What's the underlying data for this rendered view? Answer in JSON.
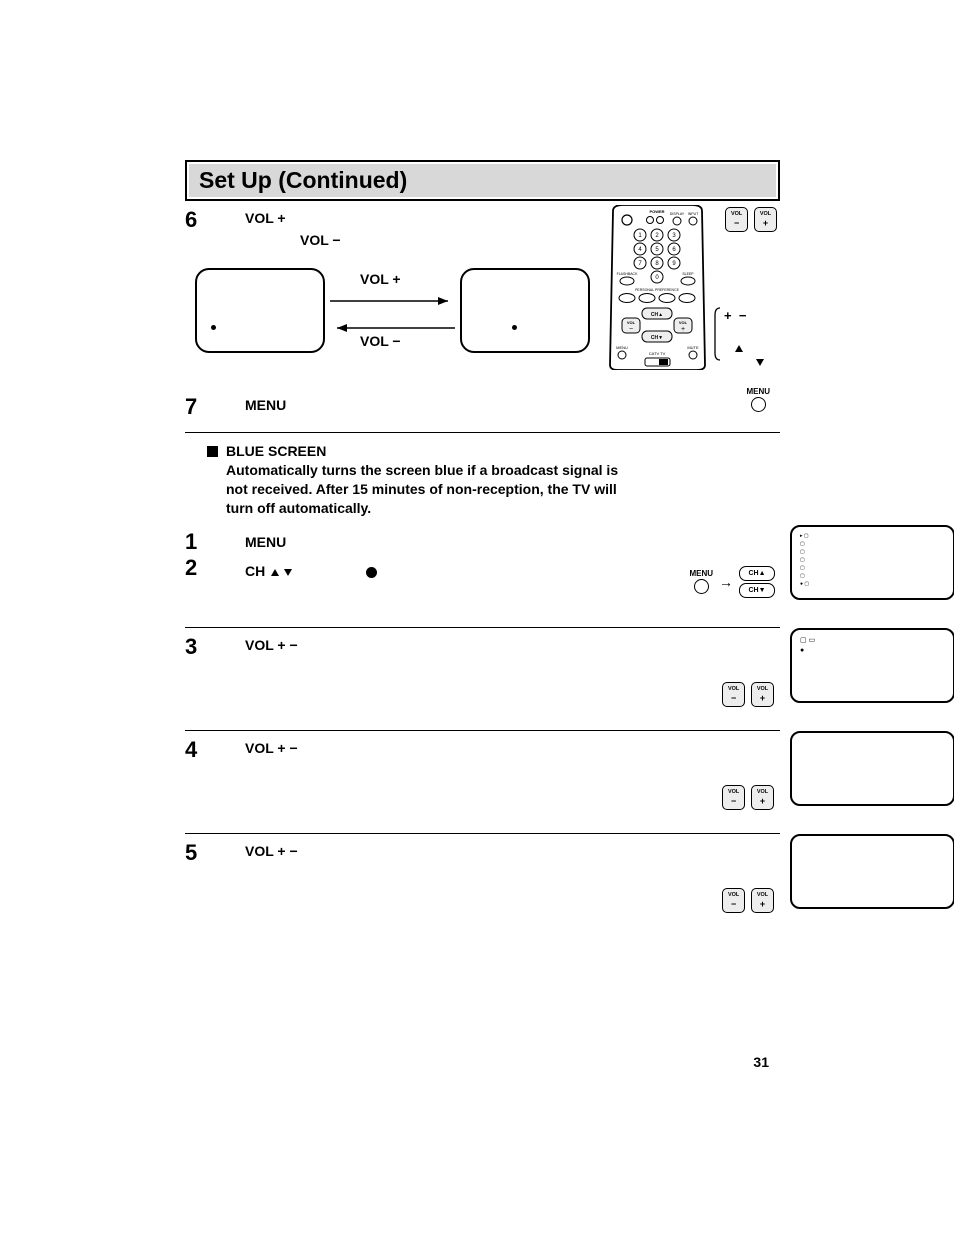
{
  "title": "Set Up (Continued)",
  "page_number": "31",
  "labels": {
    "vol": "VOL",
    "ch": "CH",
    "menu": "MENU",
    "plus": "+",
    "minus": "−",
    "plusminus": "+  −",
    "power": "POWER",
    "display": "DISPLAY",
    "input": "INPUT",
    "flashback": "FLASHBACK",
    "sleep": "SLEEP",
    "personal_preference": "PERSONAL PREFERENCE",
    "mute": "MUTE"
  },
  "steps": {
    "s6": {
      "num": "6",
      "line1": "VOL  +",
      "line2": "VOL  −",
      "arrow_top": "VOL  +",
      "arrow_bottom": "VOL  −"
    },
    "s7": {
      "num": "7",
      "text": "MENU"
    }
  },
  "blue_screen": {
    "heading": "BLUE SCREEN",
    "desc": "Automatically turns the screen blue if a broadcast signal is not received. After 15 minutes of non-reception, the TV will turn off automatically."
  },
  "steps2": {
    "s1": {
      "num": "1",
      "text": "MENU"
    },
    "s2": {
      "num": "2",
      "text": "CH"
    },
    "s3": {
      "num": "3",
      "text": "VOL  +  −"
    },
    "s4": {
      "num": "4",
      "text": "VOL  +  −"
    },
    "s5": {
      "num": "5",
      "text": "VOL  +  −"
    }
  },
  "remote_buttons": [
    "1",
    "2",
    "3",
    "4",
    "5",
    "6",
    "7",
    "8",
    "9",
    "0"
  ],
  "ch_arrows": {
    "up": "CH▲",
    "down": "CH▼"
  }
}
